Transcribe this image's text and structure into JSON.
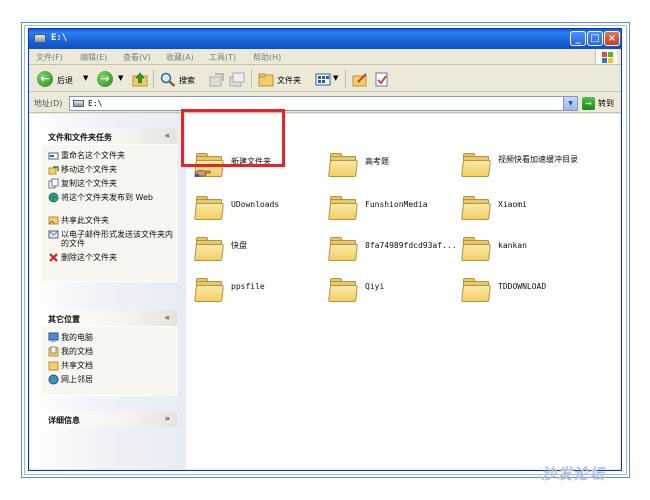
{
  "window": {
    "title": "E:\\",
    "minimize": "_",
    "maximize": "□",
    "close": "×"
  },
  "menu": [
    {
      "label": "文件(F)"
    },
    {
      "label": "编辑(E)"
    },
    {
      "label": "查看(V)"
    },
    {
      "label": "收藏(A)"
    },
    {
      "label": "工具(T)"
    },
    {
      "label": "帮助(H)"
    }
  ],
  "toolbar": {
    "back_label": "后退",
    "search_label": "搜索",
    "folders_label": "文件夹"
  },
  "address": {
    "label": "地址(D)",
    "value": "E:\\",
    "go_label": "转到"
  },
  "taskpane": {
    "file_tasks": {
      "title": "文件和文件夹任务",
      "toggle": "«",
      "items": [
        {
          "label": "重命名这个文件夹",
          "icon": "rename-icon"
        },
        {
          "label": "移动这个文件夹",
          "icon": "move-icon"
        },
        {
          "label": "复制这个文件夹",
          "icon": "copy-icon"
        },
        {
          "label": "将这个文件夹发布到 Web",
          "icon": "publish-web-icon"
        },
        {
          "label": "共享此文件夹",
          "icon": "share-icon"
        },
        {
          "label": "以电子邮件形式发送该文件夹内的文件",
          "icon": "email-icon"
        },
        {
          "label": "删除这个文件夹",
          "icon": "delete-icon"
        }
      ]
    },
    "other_places": {
      "title": "其它位置",
      "toggle": "«",
      "items": [
        {
          "label": "我的电脑",
          "icon": "my-computer-icon"
        },
        {
          "label": "我的文档",
          "icon": "my-documents-icon"
        },
        {
          "label": "共享文档",
          "icon": "shared-documents-icon"
        },
        {
          "label": "网上邻居",
          "icon": "network-places-icon"
        }
      ]
    },
    "details": {
      "title": "详细信息",
      "toggle": "»"
    }
  },
  "files": [
    {
      "name": "新建文件夹",
      "shared": true
    },
    {
      "name": "高考题"
    },
    {
      "name": "视频快看加速缓冲目录"
    },
    {
      "name": "UDownloads"
    },
    {
      "name": "FunshionMedia"
    },
    {
      "name": "Xiaomi"
    },
    {
      "name": "快盘"
    },
    {
      "name": "8fa74989fdcd93af..."
    },
    {
      "name": "kankan"
    },
    {
      "name": "ppsfile"
    },
    {
      "name": "Qiyi"
    },
    {
      "name": "TDDOWNLOAD"
    }
  ],
  "watermark": "沙发论坛",
  "colors": {
    "titlebar": "#0a5fd8",
    "highlight": "#e3242b",
    "folder": "#f2cf66"
  }
}
